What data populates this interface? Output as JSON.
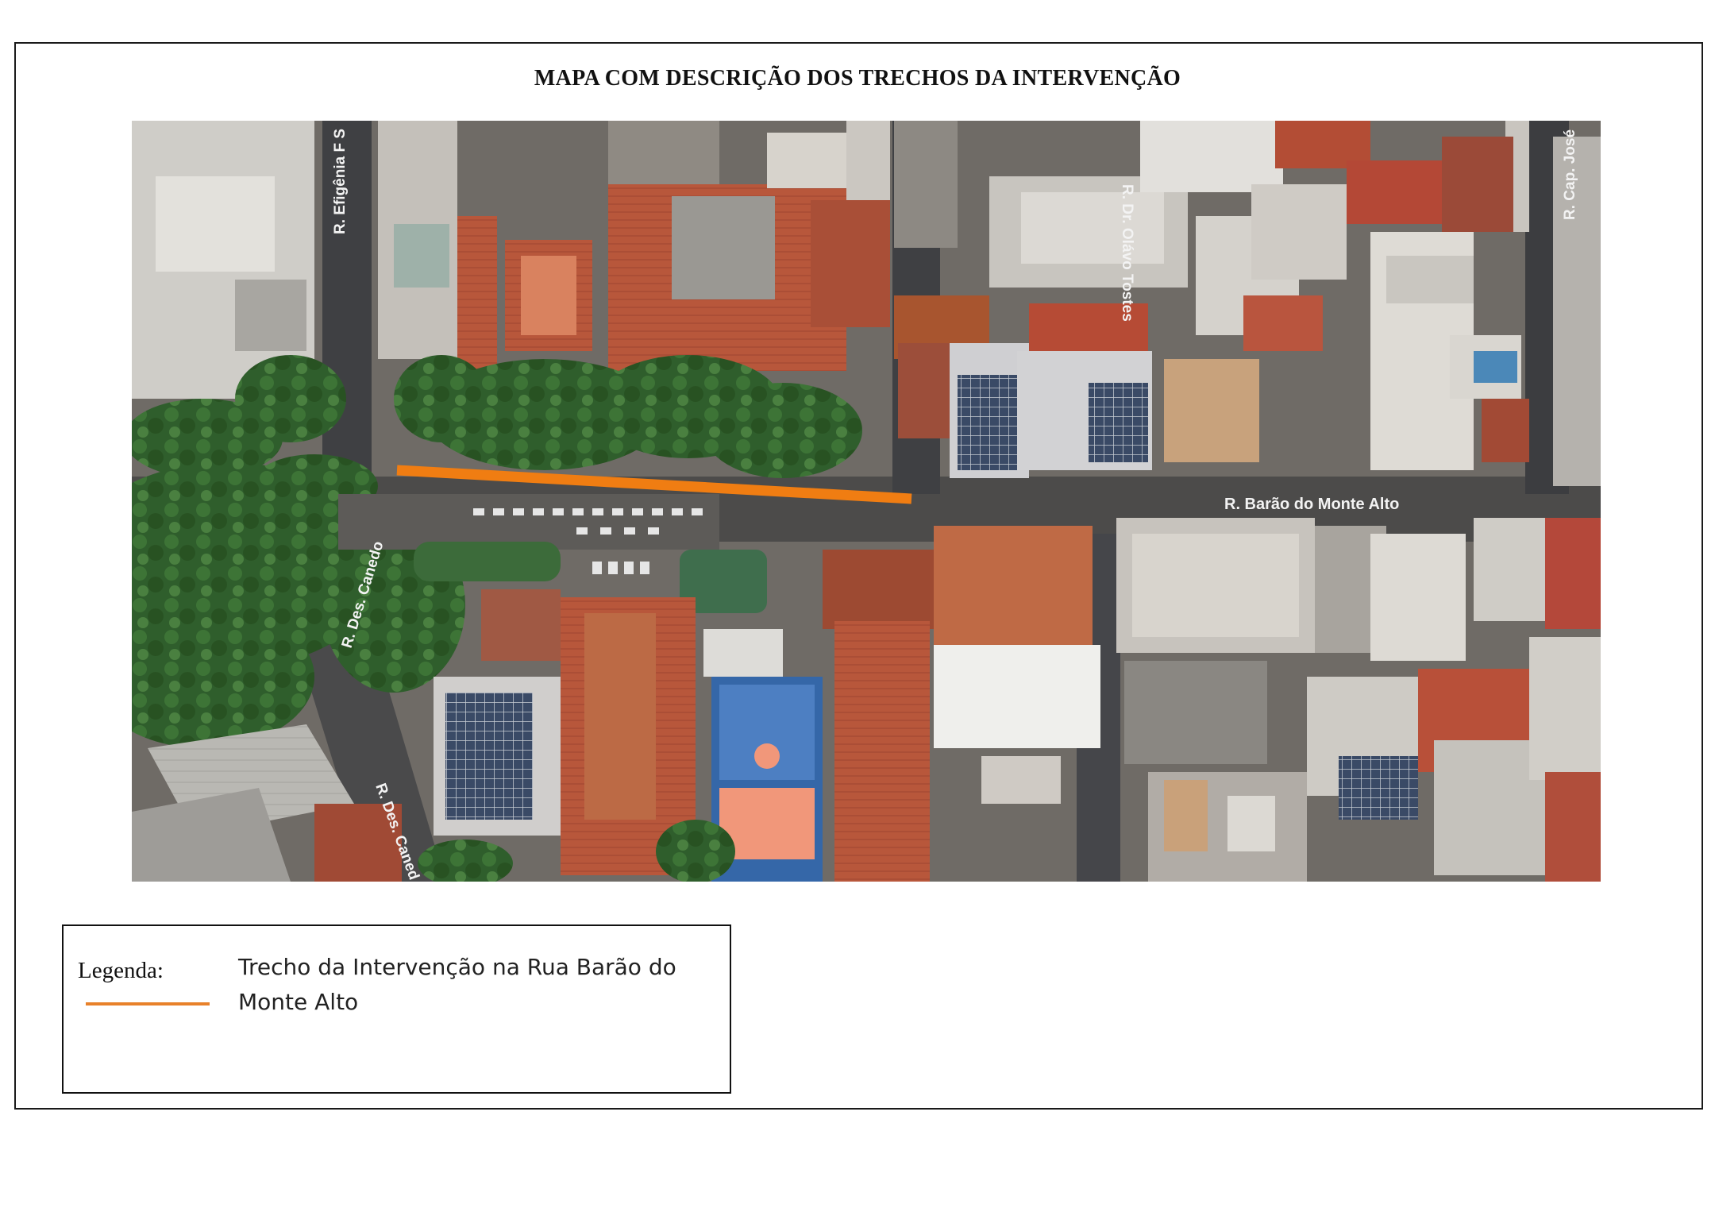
{
  "title": "MAPA COM DESCRIÇÃO DOS TRECHOS DA INTERVENÇÃO",
  "map": {
    "streets": {
      "efigenia": "R. Efigênia F S",
      "olavo": "R. Dr. Olávo Tostes",
      "cap_jose": "R. Cap. José",
      "barao": "R. Barão do Monte Alto",
      "canedo_upper": "R. Des. Canedo",
      "canedo_lower": "R. Des. Caned"
    },
    "colors": {
      "intervention": "#f07d12",
      "legend_line": "#e8812a"
    }
  },
  "legend": {
    "title": "Legenda:",
    "description": "Trecho da Intervenção na Rua Barão do Monte Alto"
  }
}
